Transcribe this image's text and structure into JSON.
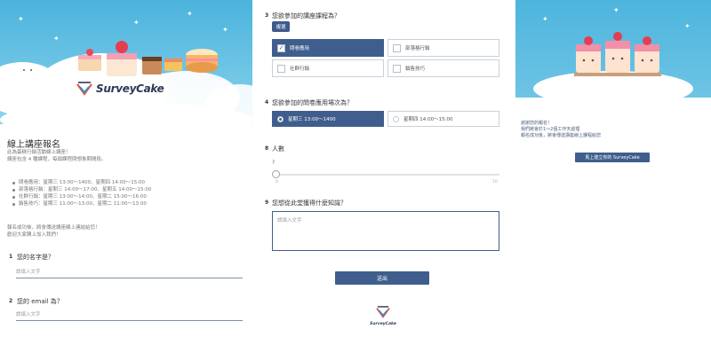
{
  "panel1": {
    "brand": "SurveyCake",
    "form_title": "線上講座報名",
    "intro": [
      "此為蛋糕行銷活動線上講座！",
      "講座包含 4 種課程，每個課程問想象期間段。"
    ],
    "schedule": [
      "問卷應用：星期三 13:00～1400、星期四 14:00～15:00",
      "部落格行銷：星期三 14:00～17:00、星期五 14:00～15:00",
      "社群行銷：星期三 13:00～14:00、星期二 15:00～16:00",
      "銷售技巧：星期三 11:00～13:00、星期二 11:00～13:00"
    ],
    "outro": [
      "報名成功後，將會傳送講座線上連結給您！",
      "歡迎大家踴上加入我們！"
    ],
    "q1": {
      "num": "1",
      "label": "您的名字是？",
      "placeholder": "請填入文字"
    },
    "q2": {
      "num": "2",
      "label": "您的 email 為？",
      "placeholder": "請填入文字"
    }
  },
  "panel2": {
    "q3": {
      "num": "3",
      "label": "您欲參加的講座課程為？",
      "badge": "複選",
      "options": [
        "問卷應用",
        "部落格行銷",
        "社群行銷",
        "銷售技巧"
      ],
      "selected": [
        true,
        false,
        false,
        false
      ]
    },
    "q4": {
      "num": "4",
      "label": "您欲參加的問卷應用場次為？",
      "options": [
        "星期三 13:00～1400",
        "星期四 14:00～15:00"
      ],
      "selected_index": 0
    },
    "q8": {
      "num": "8",
      "label": "人數",
      "value": "?",
      "min_label": "0",
      "max_label": "10",
      "level": 0
    },
    "q9": {
      "num": "9",
      "label": "您想從此堂獲得什麼知識？",
      "placeholder": "請填入文字"
    },
    "submit_label": "送出",
    "footer_brand": "SurveyCake"
  },
  "panel3": {
    "messages": [
      "謝謝您的報名！",
      "我們將會於1～2個工作天處理",
      "報名成功後，將會傳送講座線上課程給您"
    ],
    "cta_label": "馬上建立你的 SurveyCake"
  },
  "colors": {
    "accent": "#3f5e8d",
    "sky": "#4bb3dc",
    "cloud": "#ffffff"
  }
}
